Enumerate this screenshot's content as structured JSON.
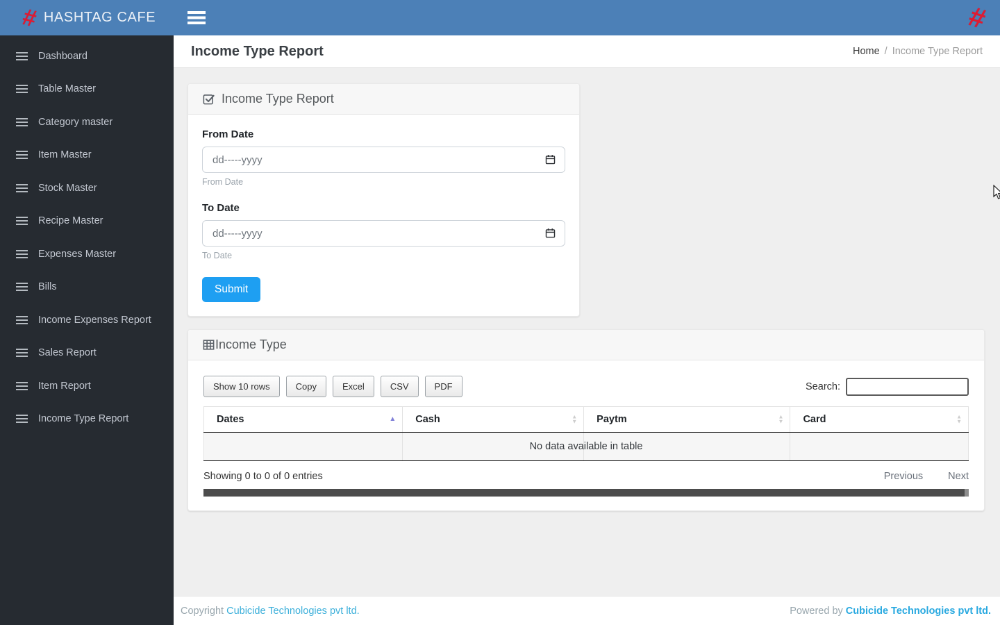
{
  "topbar": {
    "brand": "HASHTAG CAFE"
  },
  "page_header": {
    "title": "Income Type Report",
    "breadcrumb": {
      "home": "Home",
      "separator": "/",
      "current": "Income Type Report"
    }
  },
  "sidebar": {
    "items": [
      "Dashboard",
      "Table Master",
      "Category master",
      "Item Master",
      "Stock Master",
      "Recipe Master",
      "Expenses Master",
      "Bills",
      "Income Expenses Report",
      "Sales Report",
      "Item Report",
      "Income Type Report"
    ]
  },
  "filter_card": {
    "title": "Income Type Report",
    "from_date": {
      "label": "From Date",
      "placeholder": "dd-----yyyy",
      "helper": "From Date"
    },
    "to_date": {
      "label": "To Date",
      "placeholder": "dd-----yyyy",
      "helper": "To Date"
    },
    "submit_label": "Submit"
  },
  "table_card": {
    "title": "Income Type",
    "toolbar_buttons": [
      "Show 10 rows",
      "Copy",
      "Excel",
      "CSV",
      "PDF"
    ],
    "search_label": "Search:",
    "search_value": "",
    "columns": [
      "Dates",
      "Cash",
      "Paytm",
      "Card"
    ],
    "sorted_column": "Dates",
    "sort_direction": "ascending",
    "empty_message": "No data available in table",
    "info_text": "Showing 0 to 0 of 0 entries",
    "pagination": {
      "previous": "Previous",
      "next": "Next"
    }
  },
  "footer": {
    "copyright_prefix": "Copyright",
    "copyright_company": "Cubicide Technologies pvt ltd.",
    "powered_prefix": "Powered by",
    "powered_company": "Cubicide Technologies pvt ltd."
  },
  "icons": {
    "brand_logo": "red tilted hashtag",
    "menu_toggle": "hamburger",
    "sidebar_item": "hamburger-bars",
    "filter_card_title": "check-square",
    "table_card_title": "table-grid",
    "date_field": "calendar",
    "sort_active": "up-triangle",
    "sort_inactive": "up-down-triangles"
  },
  "colors": {
    "topbar_blue": "#4c80b7",
    "sidebar_dark": "#262b31",
    "brand_red": "#e01a31",
    "submit_blue": "#1e9ff2",
    "footer_link_blue": "#3bafda",
    "powered_link_blue": "#29a9e0",
    "content_bg": "#efefef",
    "sort_active_arrow": "#8080d8"
  }
}
